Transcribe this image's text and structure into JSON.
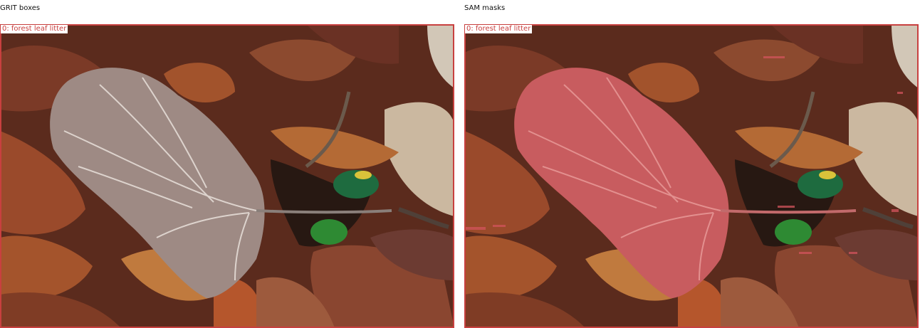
{
  "panels": [
    {
      "title": "GRIT boxes",
      "label": "0: forest leaf litter"
    },
    {
      "title": "SAM masks",
      "label": "0: forest leaf litter"
    }
  ],
  "colors": {
    "box": "#c8403f",
    "mask": "#d2545c"
  }
}
